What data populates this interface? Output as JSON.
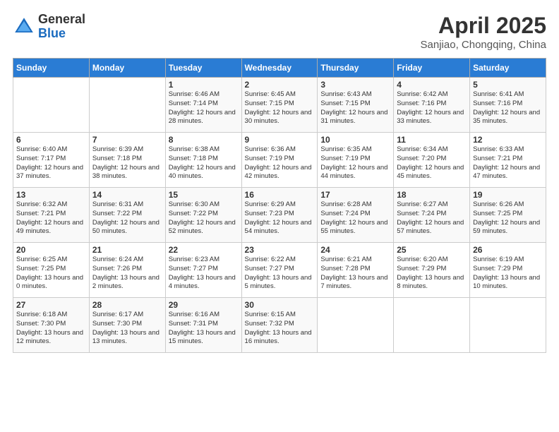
{
  "logo": {
    "general": "General",
    "blue": "Blue"
  },
  "title": "April 2025",
  "subtitle": "Sanjiao, Chongqing, China",
  "days_header": [
    "Sunday",
    "Monday",
    "Tuesday",
    "Wednesday",
    "Thursday",
    "Friday",
    "Saturday"
  ],
  "weeks": [
    [
      {
        "day": "",
        "info": ""
      },
      {
        "day": "",
        "info": ""
      },
      {
        "day": "1",
        "info": "Sunrise: 6:46 AM\nSunset: 7:14 PM\nDaylight: 12 hours and 28 minutes."
      },
      {
        "day": "2",
        "info": "Sunrise: 6:45 AM\nSunset: 7:15 PM\nDaylight: 12 hours and 30 minutes."
      },
      {
        "day": "3",
        "info": "Sunrise: 6:43 AM\nSunset: 7:15 PM\nDaylight: 12 hours and 31 minutes."
      },
      {
        "day": "4",
        "info": "Sunrise: 6:42 AM\nSunset: 7:16 PM\nDaylight: 12 hours and 33 minutes."
      },
      {
        "day": "5",
        "info": "Sunrise: 6:41 AM\nSunset: 7:16 PM\nDaylight: 12 hours and 35 minutes."
      }
    ],
    [
      {
        "day": "6",
        "info": "Sunrise: 6:40 AM\nSunset: 7:17 PM\nDaylight: 12 hours and 37 minutes."
      },
      {
        "day": "7",
        "info": "Sunrise: 6:39 AM\nSunset: 7:18 PM\nDaylight: 12 hours and 38 minutes."
      },
      {
        "day": "8",
        "info": "Sunrise: 6:38 AM\nSunset: 7:18 PM\nDaylight: 12 hours and 40 minutes."
      },
      {
        "day": "9",
        "info": "Sunrise: 6:36 AM\nSunset: 7:19 PM\nDaylight: 12 hours and 42 minutes."
      },
      {
        "day": "10",
        "info": "Sunrise: 6:35 AM\nSunset: 7:19 PM\nDaylight: 12 hours and 44 minutes."
      },
      {
        "day": "11",
        "info": "Sunrise: 6:34 AM\nSunset: 7:20 PM\nDaylight: 12 hours and 45 minutes."
      },
      {
        "day": "12",
        "info": "Sunrise: 6:33 AM\nSunset: 7:21 PM\nDaylight: 12 hours and 47 minutes."
      }
    ],
    [
      {
        "day": "13",
        "info": "Sunrise: 6:32 AM\nSunset: 7:21 PM\nDaylight: 12 hours and 49 minutes."
      },
      {
        "day": "14",
        "info": "Sunrise: 6:31 AM\nSunset: 7:22 PM\nDaylight: 12 hours and 50 minutes."
      },
      {
        "day": "15",
        "info": "Sunrise: 6:30 AM\nSunset: 7:22 PM\nDaylight: 12 hours and 52 minutes."
      },
      {
        "day": "16",
        "info": "Sunrise: 6:29 AM\nSunset: 7:23 PM\nDaylight: 12 hours and 54 minutes."
      },
      {
        "day": "17",
        "info": "Sunrise: 6:28 AM\nSunset: 7:24 PM\nDaylight: 12 hours and 55 minutes."
      },
      {
        "day": "18",
        "info": "Sunrise: 6:27 AM\nSunset: 7:24 PM\nDaylight: 12 hours and 57 minutes."
      },
      {
        "day": "19",
        "info": "Sunrise: 6:26 AM\nSunset: 7:25 PM\nDaylight: 12 hours and 59 minutes."
      }
    ],
    [
      {
        "day": "20",
        "info": "Sunrise: 6:25 AM\nSunset: 7:25 PM\nDaylight: 13 hours and 0 minutes."
      },
      {
        "day": "21",
        "info": "Sunrise: 6:24 AM\nSunset: 7:26 PM\nDaylight: 13 hours and 2 minutes."
      },
      {
        "day": "22",
        "info": "Sunrise: 6:23 AM\nSunset: 7:27 PM\nDaylight: 13 hours and 4 minutes."
      },
      {
        "day": "23",
        "info": "Sunrise: 6:22 AM\nSunset: 7:27 PM\nDaylight: 13 hours and 5 minutes."
      },
      {
        "day": "24",
        "info": "Sunrise: 6:21 AM\nSunset: 7:28 PM\nDaylight: 13 hours and 7 minutes."
      },
      {
        "day": "25",
        "info": "Sunrise: 6:20 AM\nSunset: 7:29 PM\nDaylight: 13 hours and 8 minutes."
      },
      {
        "day": "26",
        "info": "Sunrise: 6:19 AM\nSunset: 7:29 PM\nDaylight: 13 hours and 10 minutes."
      }
    ],
    [
      {
        "day": "27",
        "info": "Sunrise: 6:18 AM\nSunset: 7:30 PM\nDaylight: 13 hours and 12 minutes."
      },
      {
        "day": "28",
        "info": "Sunrise: 6:17 AM\nSunset: 7:30 PM\nDaylight: 13 hours and 13 minutes."
      },
      {
        "day": "29",
        "info": "Sunrise: 6:16 AM\nSunset: 7:31 PM\nDaylight: 13 hours and 15 minutes."
      },
      {
        "day": "30",
        "info": "Sunrise: 6:15 AM\nSunset: 7:32 PM\nDaylight: 13 hours and 16 minutes."
      },
      {
        "day": "",
        "info": ""
      },
      {
        "day": "",
        "info": ""
      },
      {
        "day": "",
        "info": ""
      }
    ]
  ]
}
